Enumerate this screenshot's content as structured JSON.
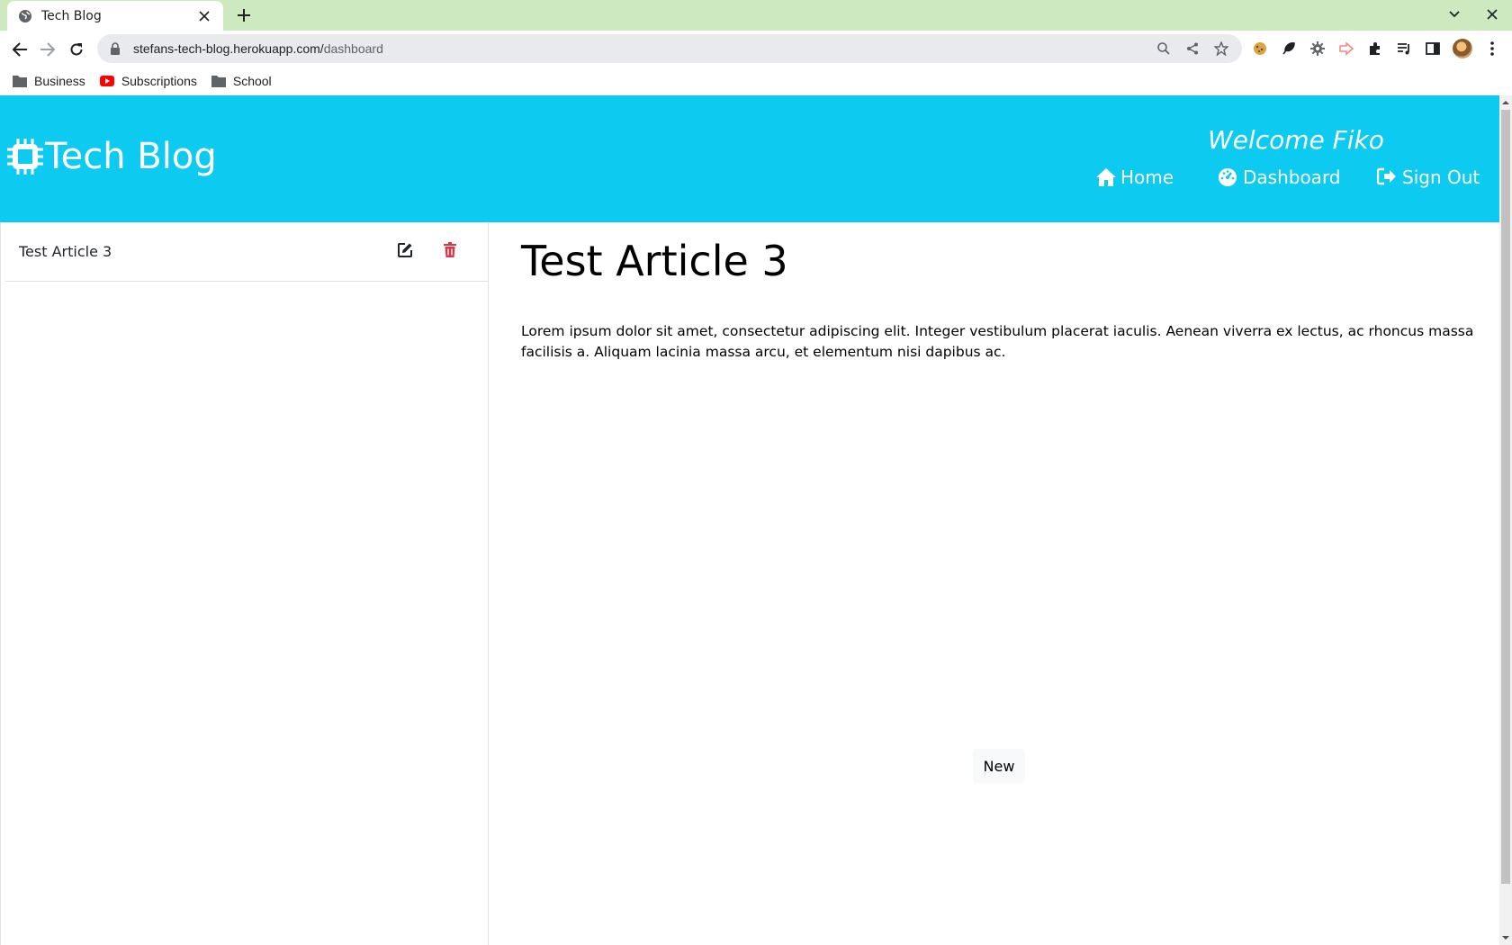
{
  "browser": {
    "tab_title": "Tech Blog",
    "url_domain": "stefans-tech-blog.herokuapp.com/",
    "url_path": "dashboard",
    "bookmarks": [
      {
        "label": "Business",
        "icon": "folder-icon"
      },
      {
        "label": "Subscriptions",
        "icon": "youtube-icon"
      },
      {
        "label": "School",
        "icon": "folder-icon"
      }
    ]
  },
  "header": {
    "logo_text": "Tech Blog",
    "welcome": "Welcome Fiko",
    "nav": {
      "home": "Home",
      "dashboard": "Dashboard",
      "signout": "Sign Out"
    }
  },
  "sidebar": {
    "posts": [
      {
        "title": "Test Article 3"
      }
    ]
  },
  "article": {
    "title": "Test Article 3",
    "body": "Lorem ipsum dolor sit amet, consectetur adipiscing elit. Integer vestibulum placerat iaculis. Aenean viverra ex lectus, ac rhoncus massa facilisis a. Aliquam lacinia massa arcu, et elementum nisi dapibus ac."
  },
  "actions": {
    "new_label": "New"
  },
  "colors": {
    "header_bg": "#0dcaf0",
    "tabbar_bg": "#cde9c0",
    "delete_red": "#dc3545"
  }
}
